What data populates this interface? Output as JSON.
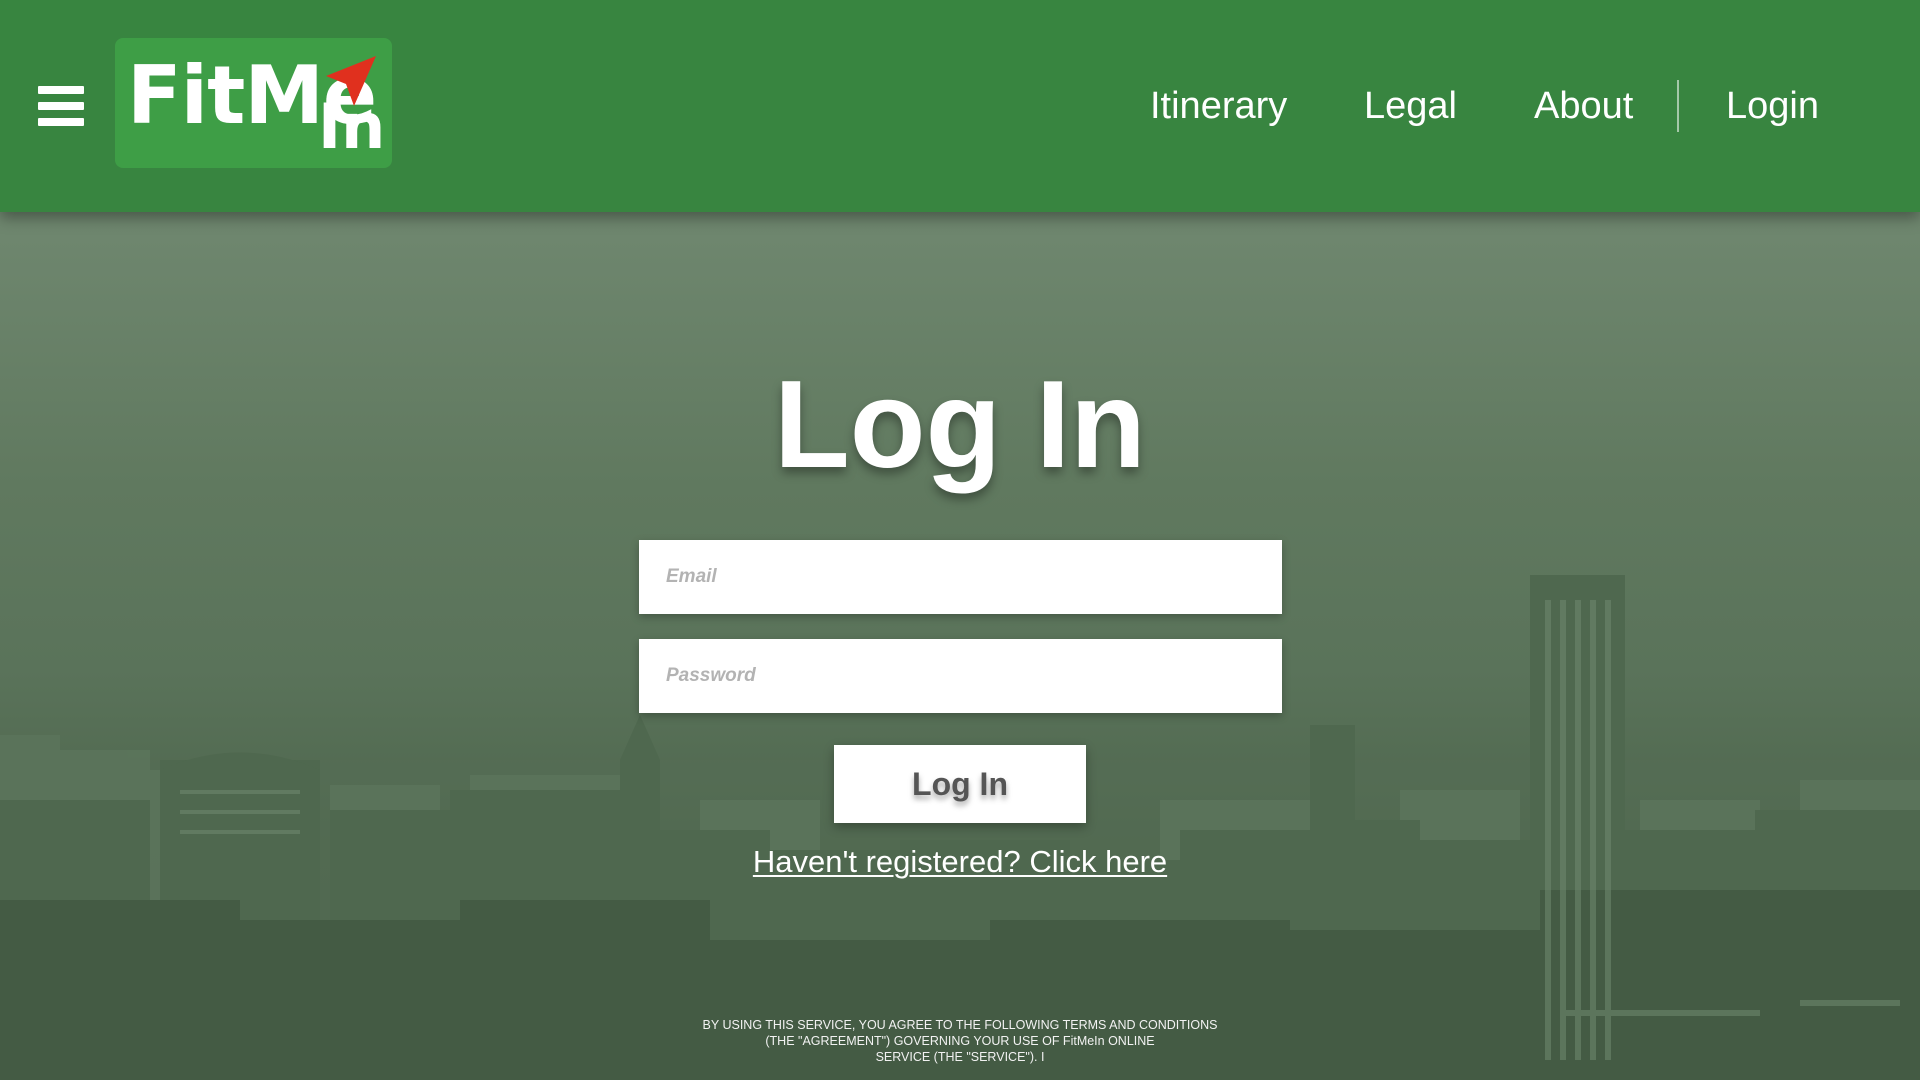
{
  "header": {
    "menu_icon": "hamburger-menu-icon",
    "logo": {
      "text_main": "FitMe",
      "text_sub": "In",
      "arrow_icon": "red-arrow-icon",
      "arrow_color": "#e0301e",
      "background_color": "#3e9e46"
    },
    "nav": [
      {
        "label": "Itinerary"
      },
      {
        "label": "Legal"
      },
      {
        "label": "About"
      },
      {
        "label": "Login"
      }
    ],
    "background_color": "#388540"
  },
  "main": {
    "title": "Log In",
    "email": {
      "placeholder": "Email",
      "value": ""
    },
    "password": {
      "placeholder": "Password",
      "value": ""
    },
    "submit_label": "Log In",
    "register_link": "Haven't registered? Click here",
    "terms": [
      "BY USING THIS SERVICE, YOU AGREE TO THE FOLLOWING TERMS AND CONDITIONS",
      "(THE \"AGREEMENT\") GOVERNING YOUR USE OF FitMeIn ONLINE",
      "SERVICE (THE \"SERVICE\"). I"
    ]
  },
  "colors": {
    "overlay_green": "#5f7a60"
  }
}
